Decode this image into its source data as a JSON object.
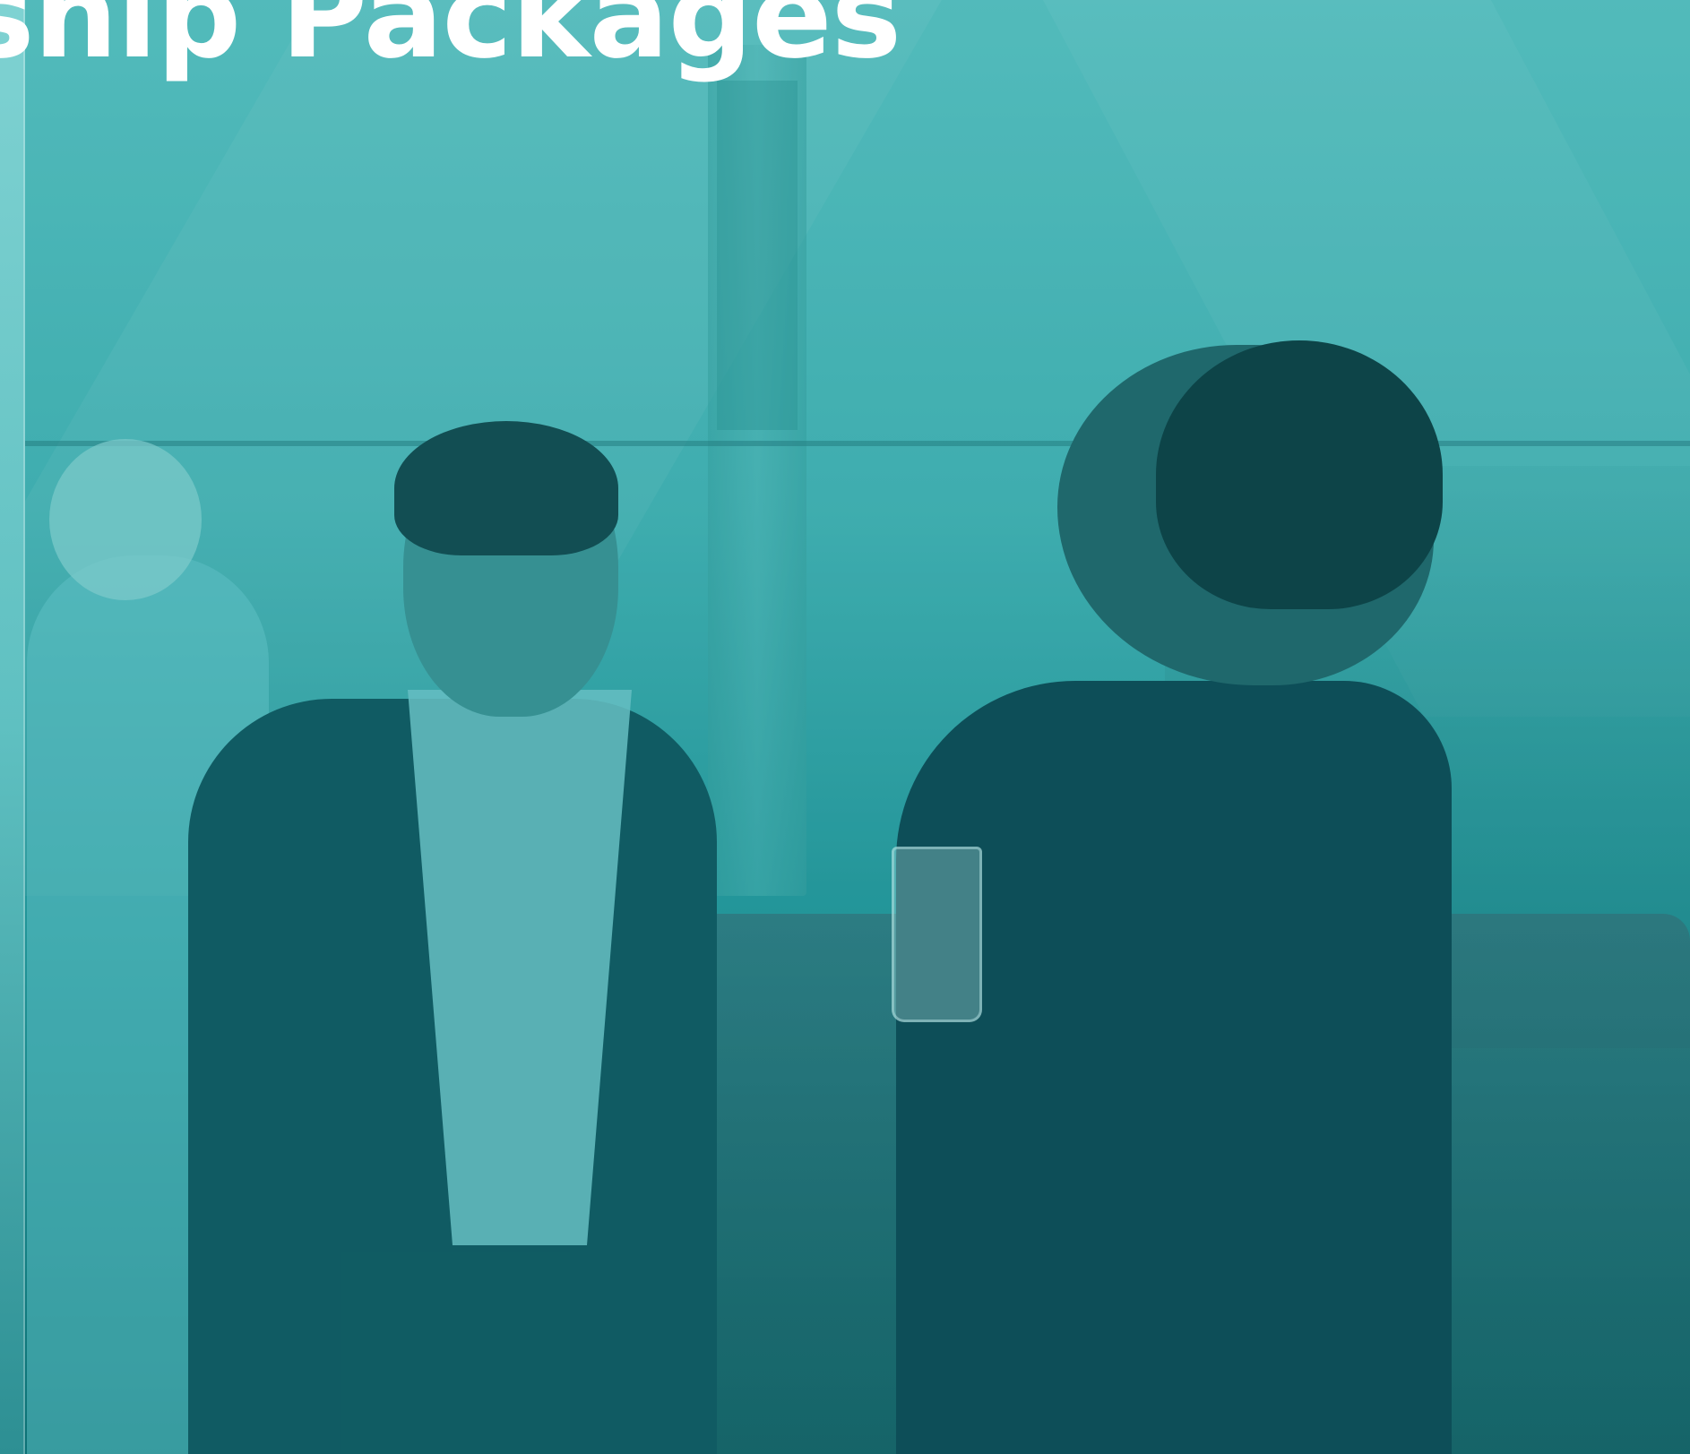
{
  "hero": {
    "title": "ship Packages",
    "overlay_color": "#2aa7a7",
    "title_color": "#ffffff"
  }
}
